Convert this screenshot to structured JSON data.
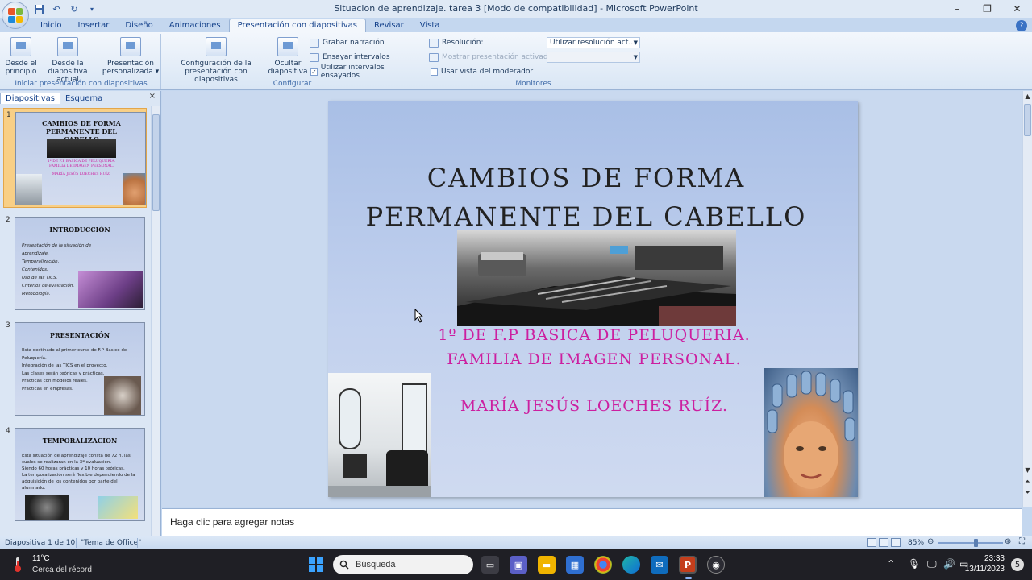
{
  "window": {
    "title": "Situacion de aprendizaje. tarea 3 [Modo de compatibilidad] - Microsoft PowerPoint",
    "controls": [
      "–",
      "❐",
      "✕"
    ]
  },
  "tabs": [
    "Inicio",
    "Insertar",
    "Diseño",
    "Animaciones",
    "Presentación con diapositivas",
    "Revisar",
    "Vista"
  ],
  "active_tab": "Presentación con diapositivas",
  "ribbon": {
    "group1": {
      "label": "Iniciar presentación con diapositivas",
      "btn_principio": "Desde el principio",
      "btn_actual": "Desde la diapositiva actual",
      "btn_personalizada": "Presentación personalizada ▾"
    },
    "group2": {
      "label": "Configurar",
      "btn_config": "Configuración de la presentación con diapositivas",
      "btn_ocultar": "Ocultar diapositiva",
      "grabar": "Grabar narración",
      "ensayar": "Ensayar intervalos",
      "usar_intervalos": "Utilizar intervalos ensayados",
      "usar_intervalos_checked": "✓"
    },
    "group3": {
      "label": "Monitores",
      "resolucion_label": "Resolución:",
      "resolucion_value": "Utilizar resolución act...",
      "mostrar_label": "Mostrar presentación activada:",
      "moderador": "Usar vista del moderador"
    }
  },
  "left_pane": {
    "tab_slides": "Diapositivas",
    "tab_outline": "Esquema",
    "close": "×",
    "slides": [
      {
        "num": "1",
        "title": "CAMBIOS DE FORMA PERMANENTE DEL CABELLO",
        "sub": "1º DE F.P BASICA DE PELUQUERIA. FAMILIA DE IMAGEN PERSONAL.",
        "author": "MARÍA JESÚS LOECHES RUÍZ."
      },
      {
        "num": "2",
        "title": "INTRODUCCIÓN",
        "bullets": [
          "Presentación de la situación de aprendizaje.",
          "Temporalización.",
          "Contenidos.",
          "Uso de las TICS.",
          "Criterios de evaluación.",
          "Metodología."
        ]
      },
      {
        "num": "3",
        "title": "PRESENTACIÓN",
        "bullets": [
          "Esta destinado al primer curso de F.P Basico de Peluquería.",
          "Integración de las TICS en el proyecto.",
          "Las clases serán teóricas y prácticas.",
          "Practicas con modelos reales.",
          "Practicas en empresas."
        ]
      },
      {
        "num": "4",
        "title": "TEMPORALIZACION",
        "bullets": [
          "Esta situación de aprendizaje consta de 72 h. las cuales se realizaran en la 3ª evaluación.",
          "Siendo 60 horas prácticas y 10 horas teóricas.",
          "La temporalización será flexible dependiendo de la adquisición de los contenidos por parte del alumnado."
        ]
      }
    ]
  },
  "slide": {
    "title_line1": "CAMBIOS DE FORMA",
    "title_line2": "PERMANENTE DEL CABELLO",
    "sub_line1": "1º DE F.P BASICA DE PELUQUERIA.",
    "sub_line2": "FAMILIA DE IMAGEN PERSONAL.",
    "author": "MARÍA JESÚS LOECHES RUÍZ.",
    "title_color": "#222222",
    "sub_color": "#cc1fa0"
  },
  "notes": {
    "placeholder": "Haga clic para agregar notas"
  },
  "status": {
    "slide_counter": "Diapositiva 1 de 10",
    "theme": "\"Tema de Office\"",
    "zoom": "85%",
    "zoom_level_percent": 85
  },
  "taskbar": {
    "temp": "11°C",
    "weather": "Cerca del récord",
    "search_placeholder": "Búsqueda",
    "time": "23:33",
    "date": "13/11/2023",
    "notif_count": "5"
  },
  "colors": {
    "accent": "#2b579a",
    "slide_bg": "#b5c7ea",
    "magenta": "#cc1fa0"
  }
}
